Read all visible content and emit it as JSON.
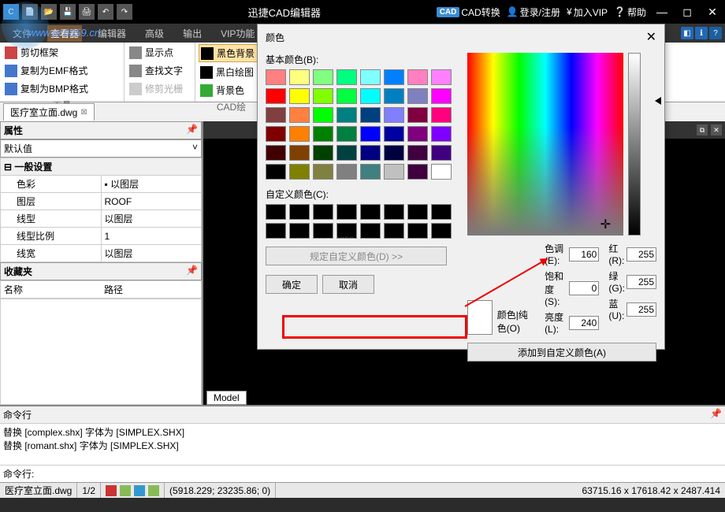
{
  "titlebar": {
    "title": "迅捷CAD编辑器",
    "cad_convert": "CAD转换",
    "login": "登录/注册",
    "vip": "加入VIP",
    "help": "帮助",
    "cad_badge": "CAD"
  },
  "menu": {
    "items": [
      "文件",
      "查看器",
      "编辑器",
      "高级",
      "输出",
      "VIP功能"
    ]
  },
  "ribbon": {
    "g1": {
      "items": [
        "剪切框架",
        "复制为EMF格式",
        "复制为BMP格式"
      ],
      "label": "工具"
    },
    "g2": {
      "items": [
        "显示点",
        "查找文字",
        "修剪光栅"
      ]
    },
    "g3": {
      "items": [
        "黑色背景",
        "黑白绘图",
        "背景色"
      ],
      "label": "CAD绘"
    }
  },
  "doc_tab": {
    "name": "医疗室立面.dwg"
  },
  "props": {
    "header": "属性",
    "default": "默认值",
    "cat": "一般设置",
    "rows": [
      {
        "k": "色彩",
        "v": "以图层"
      },
      {
        "k": "图层",
        "v": "ROOF"
      },
      {
        "k": "线型",
        "v": "以图层"
      },
      {
        "k": "线型比例",
        "v": "1"
      },
      {
        "k": "线宽",
        "v": "以图层"
      }
    ]
  },
  "fav": {
    "header": "收藏夹",
    "col1": "名称",
    "col2": "路径"
  },
  "model_tab": "Model",
  "cmd": {
    "header": "命令行",
    "log1": "替换 [complex.shx] 字体为 [SIMPLEX.SHX]",
    "log2": "替换 [romant.shx] 字体为 [SIMPLEX.SHX]",
    "prompt": "命令行:"
  },
  "status": {
    "file": "医疗室立面.dwg",
    "page": "1/2",
    "coords": "(5918.229; 23235.86; 0)",
    "right": "63715.16 x 17618.42 x 2487.414"
  },
  "dialog": {
    "title": "颜色",
    "basic_label": "基本颜色(B):",
    "custom_label": "自定义颜色(C):",
    "define_custom": "规定自定义颜色(D) >>",
    "ok": "确定",
    "cancel": "取消",
    "add_custom": "添加到自定义颜色(A)",
    "preview_label": "颜色|纯色(O)",
    "hue_l": "色调(E):",
    "hue_v": "160",
    "sat_l": "饱和度(S):",
    "sat_v": "0",
    "lum_l": "亮度(L):",
    "lum_v": "240",
    "red_l": "红(R):",
    "red_v": "255",
    "grn_l": "绿(G):",
    "grn_v": "255",
    "blu_l": "蓝(U):",
    "blu_v": "255",
    "basic_colors": [
      "#ff8080",
      "#ffff80",
      "#80ff80",
      "#00ff80",
      "#80ffff",
      "#0080ff",
      "#ff80c0",
      "#ff80ff",
      "#ff0000",
      "#ffff00",
      "#80ff00",
      "#00ff40",
      "#00ffff",
      "#0080c0",
      "#8080c0",
      "#ff00ff",
      "#804040",
      "#ff8040",
      "#00ff00",
      "#008080",
      "#004080",
      "#8080ff",
      "#800040",
      "#ff0080",
      "#800000",
      "#ff8000",
      "#008000",
      "#008040",
      "#0000ff",
      "#0000a0",
      "#800080",
      "#8000ff",
      "#400000",
      "#804000",
      "#004000",
      "#004040",
      "#000080",
      "#000040",
      "#400040",
      "#400080",
      "#000000",
      "#808000",
      "#808040",
      "#808080",
      "#408080",
      "#c0c0c0",
      "#400040",
      "#ffffff"
    ]
  },
  "watermark": {
    "url": "www.pc0359.cn",
    "mid": "www.pc0359.cn"
  }
}
